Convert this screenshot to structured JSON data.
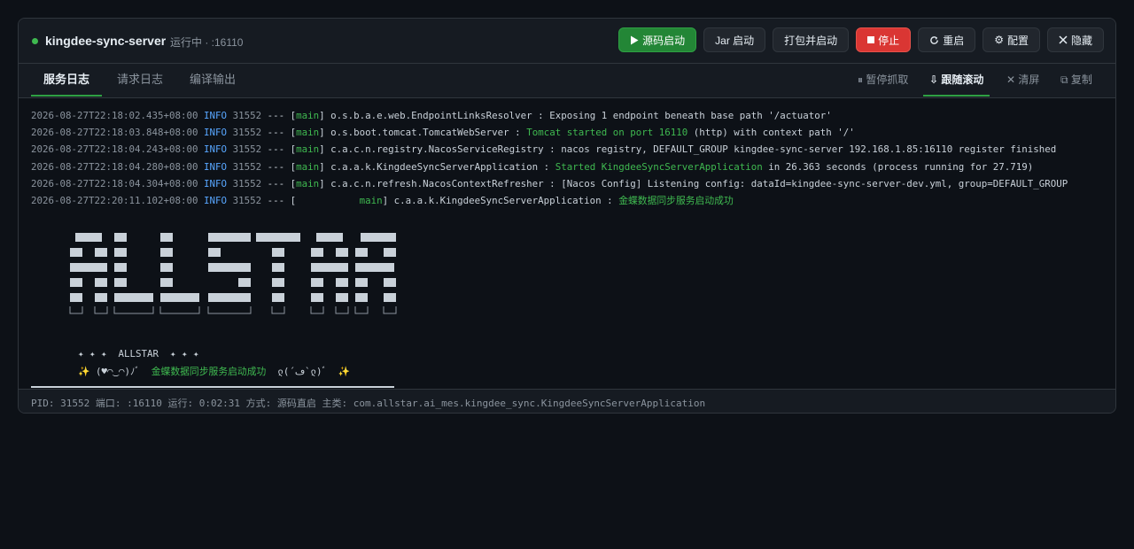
{
  "header": {
    "server_name": "kingdee-sync-server",
    "status_text": "运行中 · :16110",
    "buttons": {
      "source_start": "源码启动",
      "jar_start": "Jar 启动",
      "package_start": "打包并启动",
      "stop": "停止",
      "restart": "重启",
      "config": "配置",
      "hide": "隐藏"
    }
  },
  "tabs": [
    "服务日志",
    "请求日志",
    "编译输出"
  ],
  "toolbar": {
    "pause": "暂停抓取",
    "follow": "跟随滚动",
    "clear": "清屏",
    "copy": "复制"
  },
  "log": [
    {
      "ts": "2026-08-27T22:18:02.435+08:00",
      "level": "INFO",
      "pid": "31552",
      "sep": "---",
      "thread": "main",
      "logger": "o.s.b.a.e.web.EndpointLinksResolver",
      "msg": "Exposing 1 endpoint beneath base path '/actuator'"
    },
    {
      "ts": "2026-08-27T22:18:03.848+08:00",
      "level": "INFO",
      "pid": "31552",
      "sep": "---",
      "thread": "main",
      "logger": "o.s.boot.tomcat.TomcatWebServer",
      "msg_hl": "Tomcat started on port 16110",
      "msg": "(http) with context path '/'"
    },
    {
      "ts": "2026-08-27T22:18:04.243+08:00",
      "level": "INFO",
      "pid": "31552",
      "sep": "---",
      "thread": "main",
      "logger": "c.a.c.n.registry.NacosServiceRegistry",
      "msg": "nacos registry, DEFAULT_GROUP kingdee-sync-server 192.168.1.85:16110 register finished"
    },
    {
      "ts": "2026-08-27T22:18:04.280+08:00",
      "level": "INFO",
      "pid": "31552",
      "sep": "---",
      "thread": "main",
      "logger": "c.a.a.k.KingdeeSyncServerApplication",
      "msg_hl": "Started KingdeeSyncServerApplication",
      "msg": "in 26.363 seconds (process running for 27.719)"
    },
    {
      "ts": "2026-08-27T22:18:04.304+08:00",
      "level": "INFO",
      "pid": "31552",
      "sep": "---",
      "thread": "main",
      "logger": "c.a.c.n.refresh.NacosContextRefresher",
      "msg": "[Nacos Config] Listening config: dataId=kingdee-sync-server-dev.yml, group=DEFAULT_GROUP"
    },
    {
      "ts": "2026-08-27T22:20:11.102+08:00",
      "level": "INFO",
      "pid": "31552",
      "sep": "---",
      "thread": "           main",
      "logger": "c.a.a.k.KingdeeSyncServerApplication",
      "msg_hl": "金蝶数据同步服务启动成功",
      "msg": ""
    }
  ],
  "banner": {
    "stars_line": "✦ ✦ ✦  ALLSTAR  ✦ ✦ ✦",
    "line2_prefix": "✨ (♥◠‿◠)ﾉﾞ  ",
    "line2_highlight": "金蝶数据同步服务启动成功",
    "line2_suffix": "  ლ(´ڡ`ლ)ﾞ  ✨"
  },
  "statusbar": {
    "text": "PID: 31552 端口: :16110 运行: 0:02:31 方式: 源码直启 主类: com.allstar.ai_mes.kingdee_sync.KingdeeSyncServerApplication"
  },
  "colors": {
    "accent_green": "#238636",
    "danger_red": "#da3633",
    "info_blue": "#58a6ff",
    "highlight_green": "#3fb950"
  }
}
